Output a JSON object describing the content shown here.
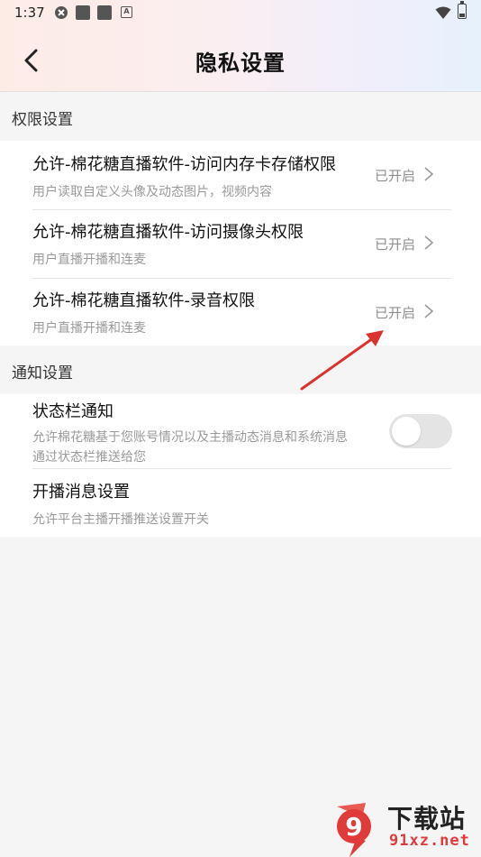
{
  "status_bar": {
    "time": "1:37",
    "notification_icons": [
      "sync-icon",
      "square-icon",
      "square-icon",
      "a-icon"
    ],
    "a_glyph": "A"
  },
  "header": {
    "title": "隐私设置",
    "back_icon": "back-chevron-icon"
  },
  "permissions": {
    "section_title": "权限设置",
    "items": [
      {
        "title": "允许-棉花糖直播软件-访问内存卡存储权限",
        "desc": "用户读取自定义头像及动态图片，视频内容",
        "status": "已开启"
      },
      {
        "title": "允许-棉花糖直播软件-访问摄像头权限",
        "desc": "用户直播开播和连麦",
        "status": "已开启"
      },
      {
        "title": "允许-棉花糖直播软件-录音权限",
        "desc": "用户直播开播和连麦",
        "status": "已开启"
      }
    ]
  },
  "notifications": {
    "section_title": "通知设置",
    "items": [
      {
        "title": "状态栏通知",
        "desc": "允许棉花糖基于您账号情况以及主播动态消息和系统消息通过状态栏推送给您",
        "toggle": false
      },
      {
        "title": "开播消息设置",
        "desc": "允许平台主播开播推送设置开关"
      }
    ]
  },
  "watermark": {
    "logo_glyph": "9",
    "text_cn": "下载站",
    "text_url": "91xz.net"
  },
  "colors": {
    "accent_red": "#d9322f",
    "toggle_off": "#e4e4e4",
    "status_text": "#8e8e8e"
  }
}
